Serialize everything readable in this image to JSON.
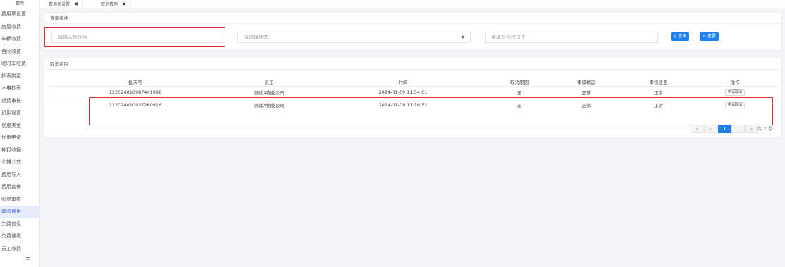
{
  "sidebar": {
    "header": "费用",
    "items": [
      {
        "label": "费用项设置"
      },
      {
        "label": "房屋收费"
      },
      {
        "label": "车辆收费"
      },
      {
        "label": "合同收费"
      },
      {
        "label": "临时车收费"
      },
      {
        "label": "抄表类型"
      },
      {
        "label": "水电抄表"
      },
      {
        "label": "退费审核"
      },
      {
        "label": "折扣设置"
      },
      {
        "label": "优惠类型"
      },
      {
        "label": "优惠申请"
      },
      {
        "label": "补打收据"
      },
      {
        "label": "公摊公式"
      },
      {
        "label": "费用导入"
      },
      {
        "label": "费用套餐"
      },
      {
        "label": "账票审核"
      },
      {
        "label": "取消费用",
        "active": true
      },
      {
        "label": "欠费信息"
      },
      {
        "label": "欠费催缴"
      },
      {
        "label": "员工收费"
      }
    ],
    "footer_icon": "menu-icon"
  },
  "tabs": [
    {
      "label": "费用项设置",
      "close": "✖"
    },
    {
      "label": "取消费用",
      "close": "✖"
    }
  ],
  "query": {
    "title": "查询条件",
    "batch_placeholder": "请输入批次号",
    "status_placeholder": "请选择状态",
    "status_arrow": "◆",
    "staff_placeholder": "请填写创建员工",
    "query_label": "查询",
    "reset_label": "重置",
    "query_icon": "search-icon",
    "reset_icon": "refresh-icon"
  },
  "list": {
    "title": "取消费用",
    "columns": [
      "批次号",
      "员工",
      "时间",
      "取消原因",
      "审核状态",
      "审核意见",
      "操作"
    ],
    "rows": [
      {
        "batch": "122024010987441998",
        "staff": "测试A物业公司",
        "time": "2024-01-09 11:54:01",
        "reason": "无",
        "status": "正常",
        "opinion": "正常",
        "action": "申请取消"
      },
      {
        "batch": "122024010937260916",
        "staff": "测试A物业公司",
        "time": "2024-01-09 11:16:52",
        "reason": "无",
        "status": "正常",
        "opinion": "正常",
        "action": "申请取消"
      }
    ]
  },
  "pagination": {
    "first": "«",
    "prev": "‹",
    "current": "1",
    "next": "›",
    "last": "»",
    "total": "共 2 条"
  },
  "colors": {
    "accent": "#1e7ff0",
    "highlight_border": "#e42a2a",
    "sidebar_active_bg": "#e6ecfb"
  }
}
